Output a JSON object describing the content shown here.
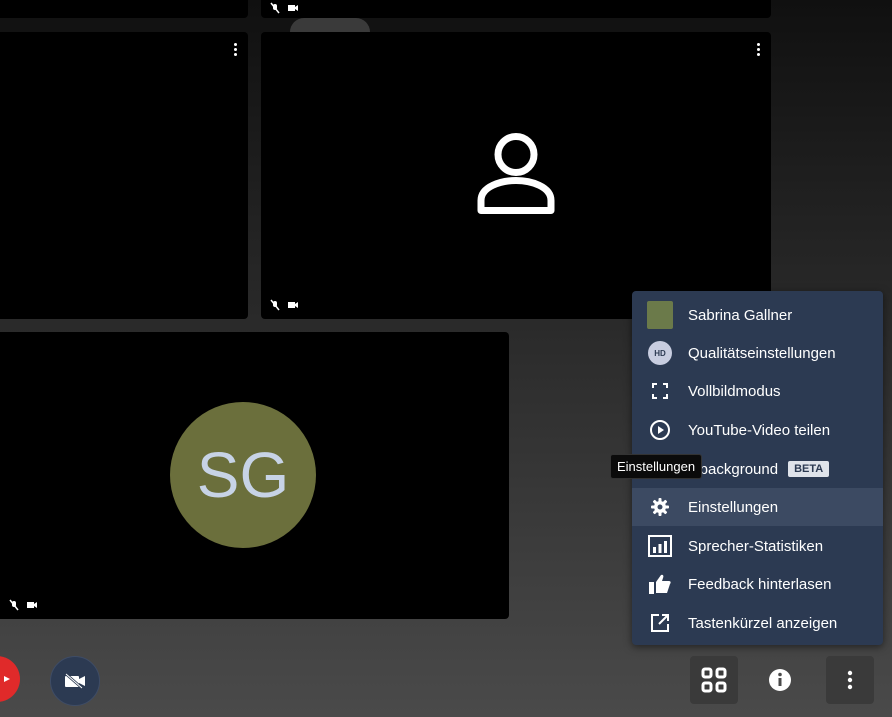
{
  "menu": {
    "items": [
      {
        "label": "Sabrina Gallner",
        "icon": "avatar-square"
      },
      {
        "label": "Qualitätseinstellungen",
        "icon": "hd-icon",
        "badge": "HD"
      },
      {
        "label": "Vollbildmodus",
        "icon": "fullscreen-icon"
      },
      {
        "label": "YouTube-Video teilen",
        "icon": "play-circle-icon"
      },
      {
        "label": "y background",
        "icon": "background-icon",
        "badge": "BETA"
      },
      {
        "label": "Einstellungen",
        "icon": "gear-icon"
      },
      {
        "label": "Sprecher-Statistiken",
        "icon": "bar-chart-icon"
      },
      {
        "label": "Feedback hinterlasen",
        "icon": "thumbs-up-icon"
      },
      {
        "label": "Tastenkürzel anzeigen",
        "icon": "external-link-icon"
      }
    ]
  },
  "tooltip": {
    "text": "Einstellungen"
  },
  "tiles": {
    "sg": {
      "initials": "SG"
    }
  },
  "colors": {
    "menu_bg": "#2c3a52",
    "avatar": "#6b6f3c",
    "hangup": "#e02a2a"
  }
}
